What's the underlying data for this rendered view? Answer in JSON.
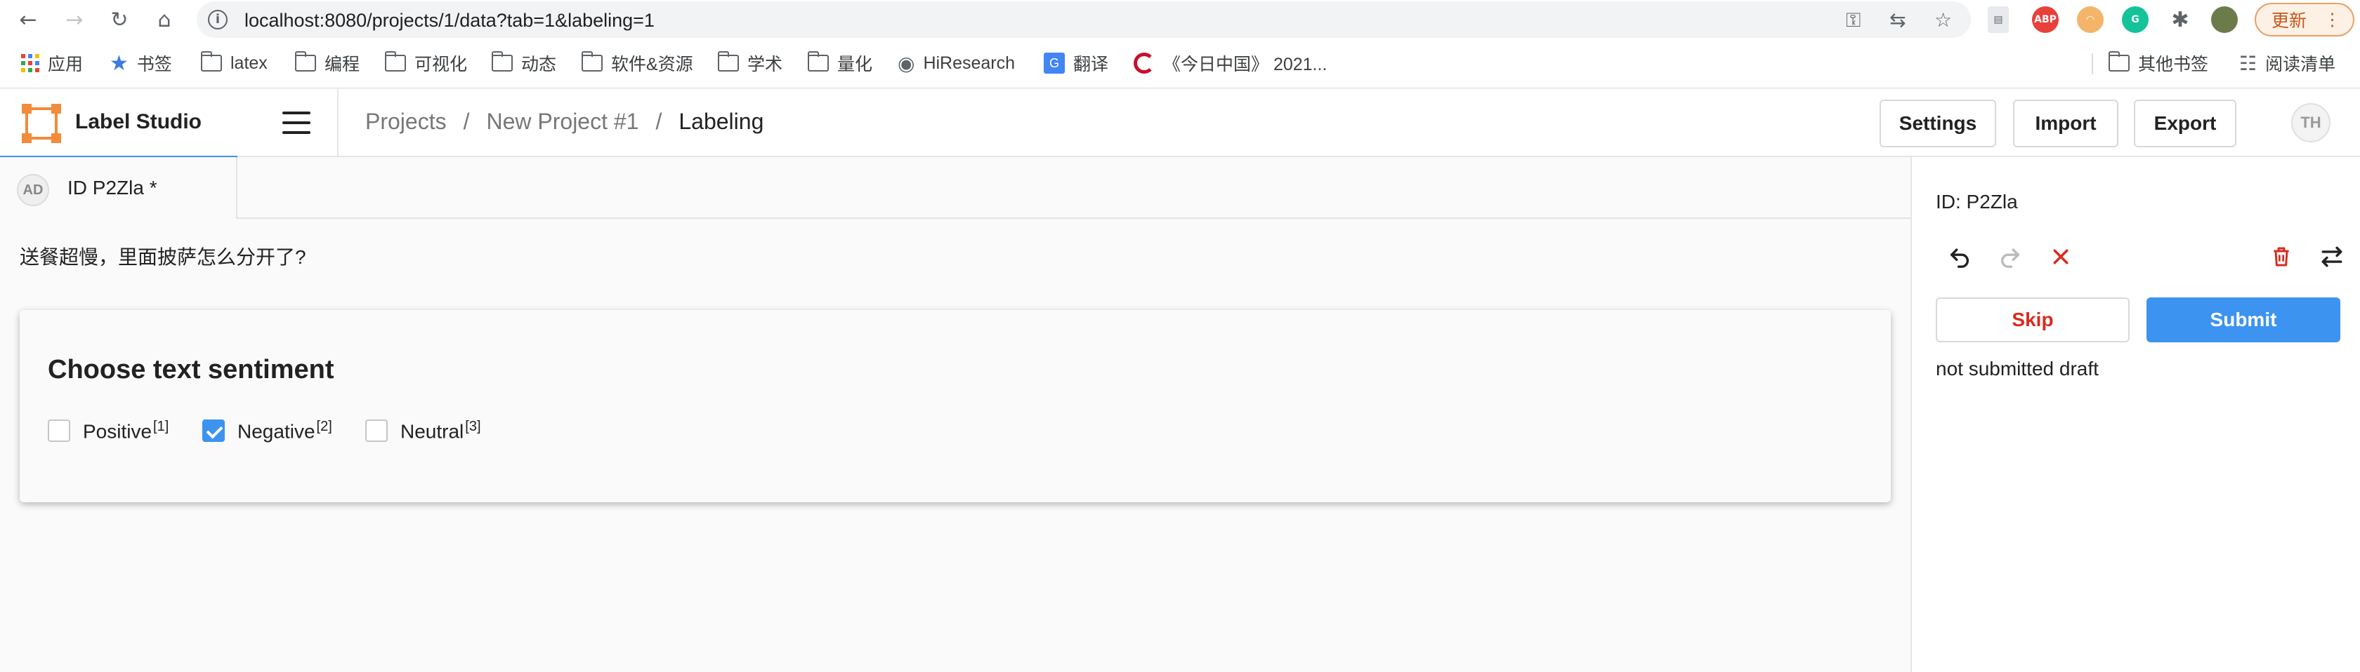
{
  "browser": {
    "url": "localhost:8080/projects/1/data?tab=1&labeling=1",
    "update_label": "更新",
    "bookmarks": [
      {
        "label": "应用",
        "icon": "apps-grid-icon"
      },
      {
        "label": "书签",
        "icon": "star-icon"
      },
      {
        "label": "latex",
        "icon": "folder-icon"
      },
      {
        "label": "编程",
        "icon": "folder-icon"
      },
      {
        "label": "可视化",
        "icon": "folder-icon"
      },
      {
        "label": "动态",
        "icon": "folder-icon"
      },
      {
        "label": "软件&资源",
        "icon": "folder-icon"
      },
      {
        "label": "学术",
        "icon": "folder-icon"
      },
      {
        "label": "量化",
        "icon": "folder-icon"
      },
      {
        "label": "HiResearch",
        "icon": "globe-icon"
      },
      {
        "label": "翻译",
        "icon": "translate-icon"
      },
      {
        "label": "《今日中国》 2021...",
        "icon": "site-logo-icon"
      },
      {
        "label": "其他书签",
        "icon": "folder-icon"
      },
      {
        "label": "阅读清单",
        "icon": "reading-list-icon"
      }
    ],
    "extensions": {
      "abp": "ABP",
      "grammarly": "G"
    }
  },
  "header": {
    "app_name": "Label Studio",
    "breadcrumb": [
      "Projects",
      "New Project #1",
      "Labeling"
    ],
    "separator": "/",
    "settings_label": "Settings",
    "import_label": "Import",
    "export_label": "Export",
    "user_initials": "TH"
  },
  "task_tab": {
    "avatar_initials": "AD",
    "title": "ID P2Zla *"
  },
  "task": {
    "text": "送餐超慢，里面披萨怎么分开了?",
    "question": "Choose text sentiment",
    "choices": [
      {
        "label": "Positive",
        "hotkey": "[1]",
        "checked": false
      },
      {
        "label": "Negative",
        "hotkey": "[2]",
        "checked": true
      },
      {
        "label": "Neutral",
        "hotkey": "[3]",
        "checked": false
      }
    ]
  },
  "sidebar": {
    "id_text": "ID: P2Zla",
    "skip_label": "Skip",
    "submit_label": "Submit",
    "status_text": "not submitted draft"
  },
  "colors": {
    "accent": "#3c93f0",
    "brand": "#f28b3a",
    "danger": "#d92b1e"
  }
}
